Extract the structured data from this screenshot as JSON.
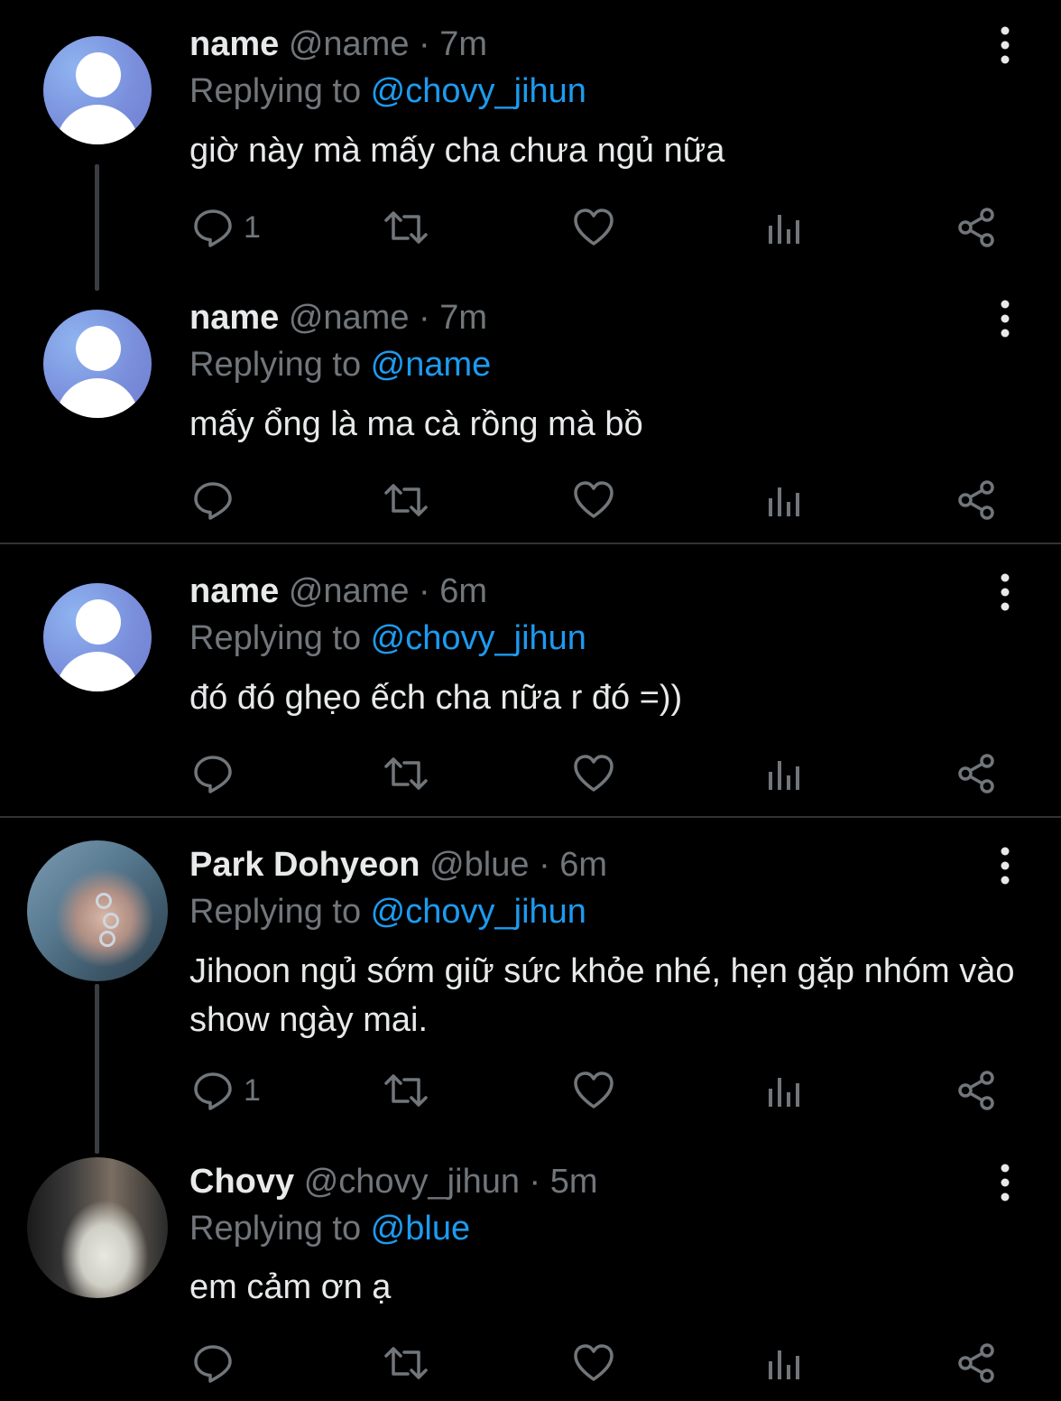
{
  "colors": {
    "background": "#000000",
    "text": "#e7e9ea",
    "muted": "#71767b",
    "link": "#1d9bf0",
    "divider": "#2f3336"
  },
  "icons": [
    "reply-icon",
    "retweet-icon",
    "like-icon",
    "analytics-icon",
    "share-icon",
    "more-icon"
  ],
  "tweets": [
    {
      "display_name": "name",
      "handle_time": "@name · 7m",
      "replying_prefix": "Replying to ",
      "replying_to": "@chovy_jihun",
      "text": "giờ này mà mấy cha chưa ngủ nữa",
      "reply_count": "1"
    },
    {
      "display_name": "name",
      "handle_time": "@name · 7m",
      "replying_prefix": "Replying to ",
      "replying_to": "@name",
      "text": "mấy ổng là ma cà rồng mà bồ",
      "reply_count": ""
    },
    {
      "display_name": "name",
      "handle_time": "@name · 6m",
      "replying_prefix": "Replying to ",
      "replying_to": "@chovy_jihun",
      "text": "đó đó ghẹo ếch cha nữa r đó =))",
      "reply_count": ""
    },
    {
      "display_name": "Park Dohyeon",
      "handle_time": "@blue · 6m",
      "replying_prefix": "Replying to ",
      "replying_to": "@chovy_jihun",
      "text": "Jihoon ngủ sớm giữ sức khỏe nhé, hẹn gặp nhóm vào show ngày mai.",
      "reply_count": "1"
    },
    {
      "display_name": "Chovy",
      "handle_time": "@chovy_jihun · 5m",
      "replying_prefix": "Replying to ",
      "replying_to": "@blue",
      "text": "em cảm ơn ạ",
      "reply_count": ""
    }
  ]
}
